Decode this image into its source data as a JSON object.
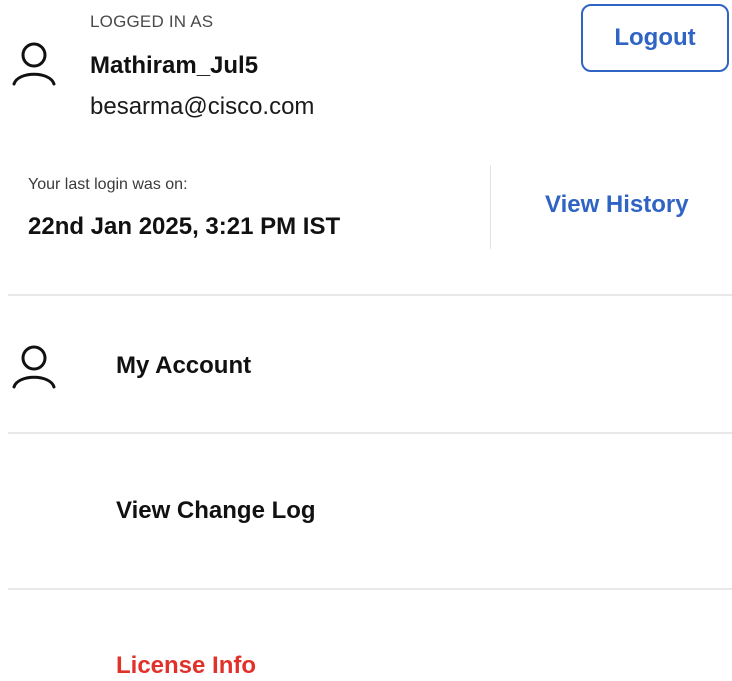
{
  "user": {
    "logged_in_label": "LOGGED IN AS",
    "username": "Mathiram_Jul5",
    "email": "besarma@cisco.com",
    "icon": "user-icon"
  },
  "actions": {
    "logout_label": "Logout",
    "view_history_label": "View History"
  },
  "last_login": {
    "label": "Your last login was on:",
    "value": "22nd Jan 2025, 3:21 PM IST"
  },
  "menu": {
    "items": [
      {
        "label": "My Account",
        "icon": "user-icon"
      },
      {
        "label": "View Change Log"
      },
      {
        "label": "License Info",
        "color": "#e0322b"
      }
    ]
  },
  "colors": {
    "accent": "#2f64c4",
    "danger": "#e0322b",
    "divider": "#e8e8e8"
  }
}
